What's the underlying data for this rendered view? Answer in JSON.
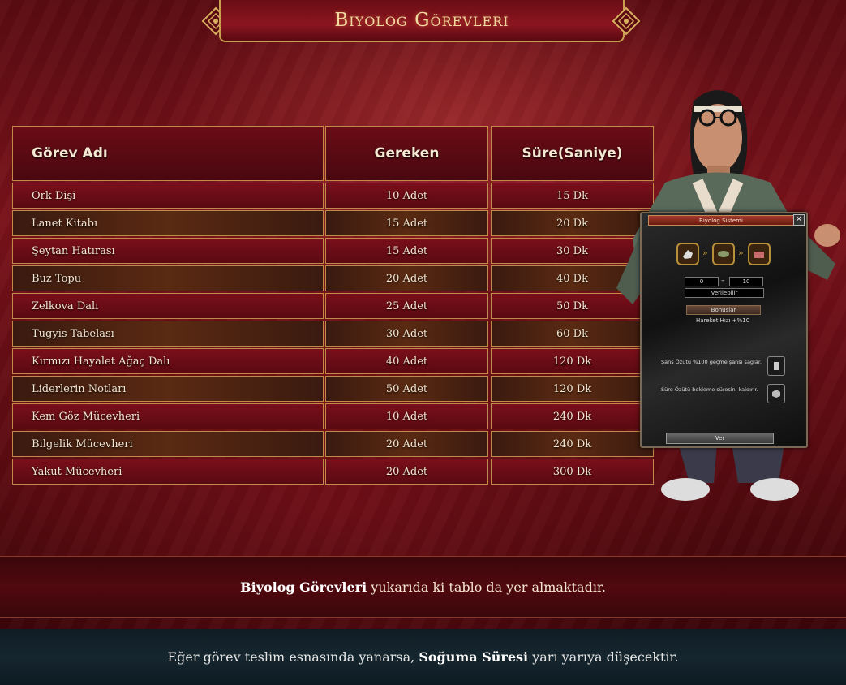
{
  "header": {
    "title": "Biyolog Görevleri"
  },
  "table": {
    "headers": [
      "Görev Adı",
      "Gereken",
      "Süre(Saniye)"
    ],
    "rows": [
      [
        "Ork Dişi",
        "10 Adet",
        "15 Dk"
      ],
      [
        "Lanet Kitabı",
        "15 Adet",
        "20 Dk"
      ],
      [
        "Şeytan Hatırası",
        "15 Adet",
        "30 Dk"
      ],
      [
        "Buz Topu",
        "20 Adet",
        "40 Dk"
      ],
      [
        "Zelkova Dalı",
        "25 Adet",
        "50 Dk"
      ],
      [
        "Tugyis Tabelası",
        "30 Adet",
        "60 Dk"
      ],
      [
        "Kırmızı Hayalet Ağaç Dalı",
        "40 Adet",
        "120 Dk"
      ],
      [
        "Liderlerin Notları",
        "50 Adet",
        "120 Dk"
      ],
      [
        "Kem Göz Mücevheri",
        "10 Adet",
        "240 Dk"
      ],
      [
        "Bilgelik Mücevheri",
        "20 Adet",
        "240 Dk"
      ],
      [
        "Yakut Mücevheri",
        "20 Adet",
        "300 Dk"
      ]
    ]
  },
  "info": {
    "highlight": "Biyolog Görevleri",
    "rest": " yukarıda ki tablo da yer almaktadır."
  },
  "cooldown": {
    "prefix": "Eğer görev teslim esnasında yanarsa, ",
    "highlight": "Soğuma Süresi",
    "suffix": " yarı yarıya düşecektir."
  },
  "window": {
    "title": "Biyolog Sistemi",
    "close": "✕",
    "count_current": "0",
    "count_total": "10",
    "status": "Verilebilir",
    "bonus_label": "Bonuslar",
    "bonus_value": "Hareket Hızı +%10",
    "chance_text": "Şans Özütü %100 geçme şansı sağlar.",
    "time_text": "Süre Özütü bekleme süresini kaldırır.",
    "give_button": "Ver"
  },
  "colors": {
    "accent_gold": "#c8a050",
    "row_red": "#7a0f1a",
    "row_dark": "#4a2210",
    "footer_teal": "#16262f"
  }
}
